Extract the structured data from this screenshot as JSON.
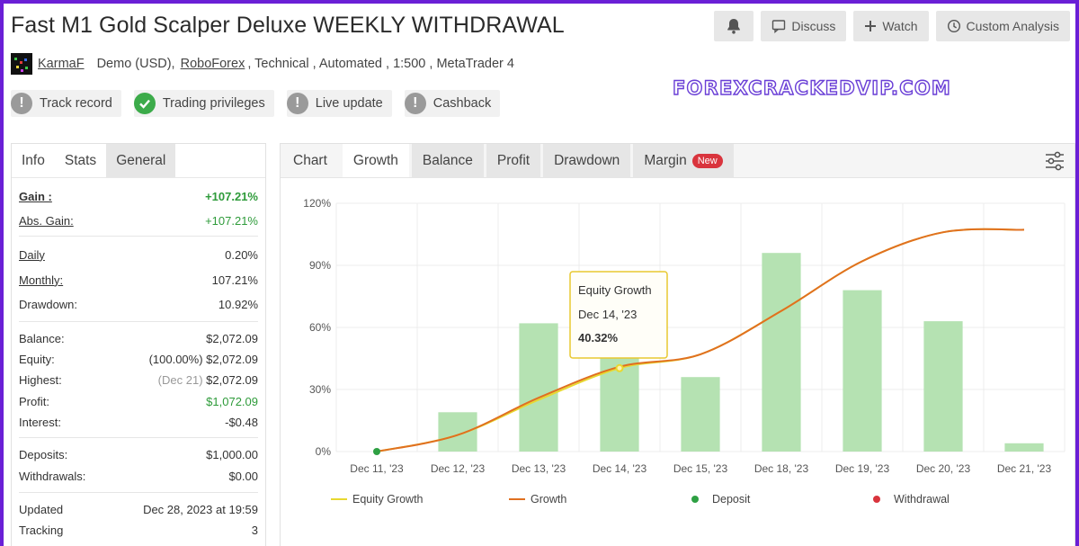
{
  "title": "Fast M1 Gold Scalper Deluxe WEEKLY WITHDRAWAL",
  "top_buttons": {
    "bell_icon": "bell-icon",
    "discuss": "Discuss",
    "watch": "Watch",
    "custom_analysis": "Custom Analysis"
  },
  "meta": {
    "author": "KarmaF",
    "account": "Demo (USD),",
    "broker": "RoboForex",
    "details": ", Technical , Automated , 1:500 , MetaTrader 4"
  },
  "watermark": "FOREXCRACKEDVIP.COM",
  "badges": [
    {
      "label": "Track record",
      "status": "warning"
    },
    {
      "label": "Trading privileges",
      "status": "ok"
    },
    {
      "label": "Live update",
      "status": "warning"
    },
    {
      "label": "Cashback",
      "status": "warning"
    }
  ],
  "left_tabs": [
    "Info",
    "Stats",
    "General"
  ],
  "stats": {
    "gain": {
      "label": "Gain :",
      "value": "+107.21%"
    },
    "abs_gain": {
      "label": "Abs. Gain:",
      "value": "+107.21%"
    },
    "daily": {
      "label": "Daily",
      "value": "0.20%"
    },
    "monthly": {
      "label": "Monthly:",
      "value": "107.21%"
    },
    "drawdown": {
      "label": "Drawdown:",
      "value": "10.92%"
    },
    "balance": {
      "label": "Balance:",
      "value": "$2,072.09"
    },
    "equity": {
      "label": "Equity:",
      "value": "(100.00%) $2,072.09"
    },
    "highest": {
      "label": "Highest:",
      "note": "(Dec 21)",
      "value": "$2,072.09"
    },
    "profit": {
      "label": "Profit:",
      "value": "$1,072.09"
    },
    "interest": {
      "label": "Interest:",
      "value": "-$0.48"
    },
    "deposits": {
      "label": "Deposits:",
      "value": "$1,000.00"
    },
    "withdrawals": {
      "label": "Withdrawals:",
      "value": "$0.00"
    },
    "updated": {
      "label": "Updated",
      "value": "Dec 28, 2023 at 19:59"
    },
    "tracking": {
      "label": "Tracking",
      "value": "3"
    }
  },
  "chart_tabs": {
    "label": "Chart",
    "tabs": [
      "Growth",
      "Balance",
      "Profit",
      "Drawdown",
      "Margin"
    ],
    "active": "Growth",
    "new_badge": "New"
  },
  "tooltip": {
    "series": "Equity Growth",
    "date": "Dec 14, '23",
    "value": "40.32%"
  },
  "colors": {
    "bar": "#b5e2b2",
    "growth_line": "#e07020",
    "equity_line": "#e8d830",
    "deposit": "#2ea043",
    "withdrawal": "#d9343d"
  },
  "chart_data": {
    "type": "bar",
    "categories": [
      "Dec 11, '23",
      "Dec 12, '23",
      "Dec 13, '23",
      "Dec 14, '23",
      "Dec 15, '23",
      "Dec 18, '23",
      "Dec 19, '23",
      "Dec 20, '23",
      "Dec 21, '23"
    ],
    "y_tick_labels": [
      "0%",
      "30%",
      "60%",
      "90%",
      "120%"
    ],
    "ylim": [
      0,
      120
    ],
    "bars": [
      0,
      19,
      62,
      48,
      36,
      96,
      78,
      63,
      4
    ],
    "series": [
      {
        "name": "Growth",
        "type": "line",
        "values": [
          0,
          8,
          26,
          41,
          47,
          68,
          92,
          106,
          107.21
        ]
      },
      {
        "name": "Equity Growth",
        "type": "line",
        "values": [
          0,
          8,
          25,
          40.32,
          47,
          68,
          92,
          106,
          107.21
        ]
      }
    ],
    "deposit_point": {
      "x": "Dec 11, '23",
      "y": 0
    },
    "legend": [
      "Equity Growth",
      "Growth",
      "Deposit",
      "Withdrawal"
    ],
    "legend_position": "bottom",
    "grid": true
  }
}
